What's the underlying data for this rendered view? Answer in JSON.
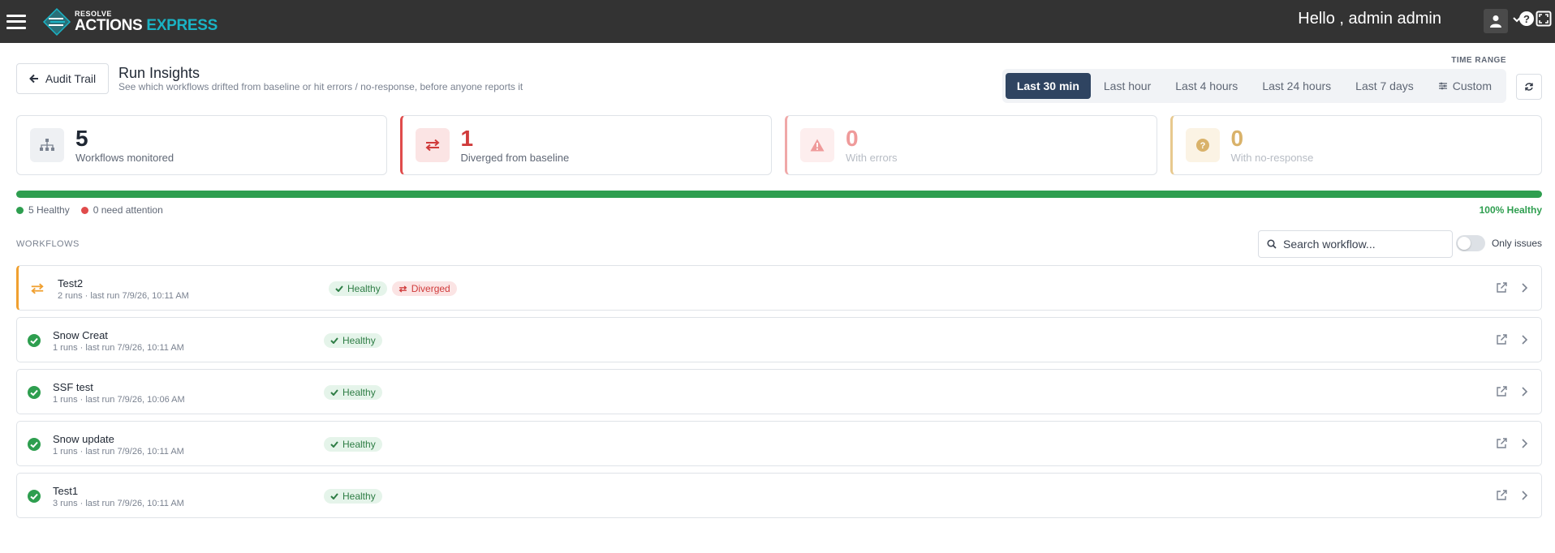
{
  "topbar": {
    "logo_small": "RESOLVE",
    "logo_word1": "ACTIONS",
    "logo_word2": "EXPRESS",
    "greeting": "Hello , admin admin",
    "help_glyph": "?"
  },
  "header": {
    "back_label": "Audit Trail",
    "title": "Run Insights",
    "subtitle": "See which workflows drifted from baseline or hit errors / no-response, before anyone reports it",
    "time_range_label": "TIME RANGE",
    "time_ranges": [
      "Last 30 min",
      "Last hour",
      "Last 4 hours",
      "Last 24 hours",
      "Last 7 days",
      "Custom"
    ],
    "active_time_range": "Last 30 min"
  },
  "stats": [
    {
      "value": "5",
      "label": "Workflows monitored",
      "icon": "sitemap-icon",
      "color": "#2c3340"
    },
    {
      "value": "1",
      "label": "Diverged from baseline",
      "icon": "arrows-exchange-icon",
      "color": "#d03b3b"
    },
    {
      "value": "0",
      "label": "With errors",
      "icon": "warning-icon",
      "color": "#ef9a9a"
    },
    {
      "value": "0",
      "label": "With no-response",
      "icon": "question-icon",
      "color": "#d9b26a"
    }
  ],
  "health": {
    "healthy_fraction": 1.0,
    "healthy_label": "5 Healthy",
    "attention_label": "0 need attention",
    "percent_label": "100% Healthy",
    "healthy_color": "#2e9e4f",
    "attention_color": "#e04b4b"
  },
  "workflows_section": {
    "heading": "WORKFLOWS",
    "search_placeholder": "Search workflow...",
    "toggle_label": "Only issues",
    "toggle_on": false
  },
  "workflows": [
    {
      "name": "Test2",
      "meta": "2 runs · last run 7/9/26, 10:11 AM",
      "status": "diverged",
      "badges": [
        "Healthy",
        "Diverged"
      ]
    },
    {
      "name": "Snow Creat",
      "meta": "1 runs · last run 7/9/26, 10:11 AM",
      "status": "healthy",
      "badges": [
        "Healthy"
      ]
    },
    {
      "name": "SSF test",
      "meta": "1 runs · last run 7/9/26, 10:06 AM",
      "status": "healthy",
      "badges": [
        "Healthy"
      ]
    },
    {
      "name": "Snow update",
      "meta": "1 runs · last run 7/9/26, 10:11 AM",
      "status": "healthy",
      "badges": [
        "Healthy"
      ]
    },
    {
      "name": "Test1",
      "meta": "3 runs · last run 7/9/26, 10:11 AM",
      "status": "healthy",
      "badges": [
        "Healthy"
      ]
    }
  ]
}
